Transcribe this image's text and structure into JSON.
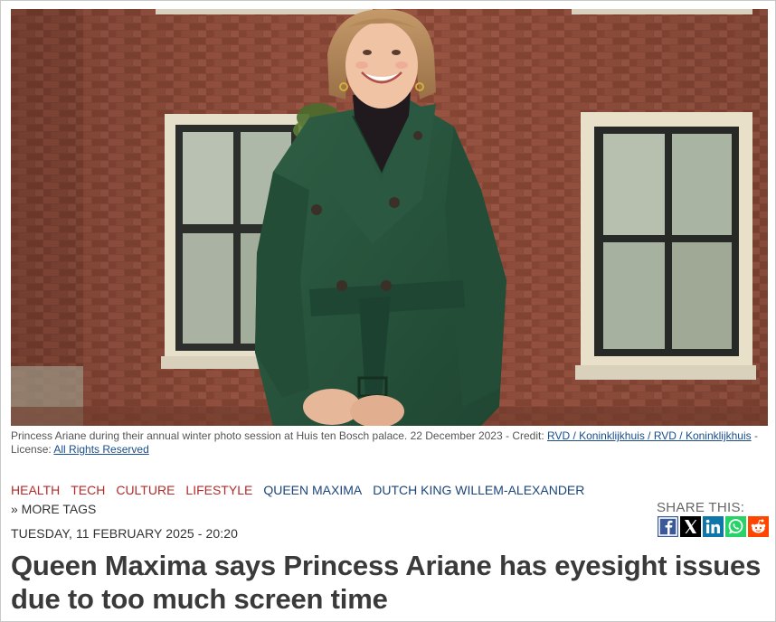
{
  "photo": {
    "alt": "Princess Ariane wearing a green belted wool coat in front of a brick building with white-framed windows"
  },
  "caption": {
    "text": "Princess Ariane during their annual winter photo session at Huis ten Bosch palace. 22 December 2023 - Credit: ",
    "credit_link": "RVD / Koninklijkhuis / RVD / Koninklijkhuis",
    "separator": " - ",
    "license_label": "License: ",
    "license_link": "All Rights Reserved"
  },
  "tags": {
    "items": [
      {
        "label": "HEALTH",
        "color": "#b52b2b"
      },
      {
        "label": "TECH",
        "color": "#b52b2b"
      },
      {
        "label": "CULTURE",
        "color": "#b52b2b"
      },
      {
        "label": "LIFESTYLE",
        "color": "#b52b2b"
      },
      {
        "label": "QUEEN MAXIMA",
        "color": "#1c4578"
      },
      {
        "label": "DUTCH KING WILLEM-ALEXANDER",
        "color": "#1c4578"
      }
    ],
    "more_label": "» MORE TAGS"
  },
  "article": {
    "date": "TUESDAY, 11 FEBRUARY 2025 - 20:20",
    "headline": "Queen Maxima says Princess Ariane has eyesight issues due to too much screen time"
  },
  "share": {
    "label": "SHARE THIS:",
    "buttons": [
      {
        "name": "facebook",
        "icon": "facebook-icon",
        "color": "#3b5998"
      },
      {
        "name": "x",
        "icon": "x-icon",
        "color": "#000000"
      },
      {
        "name": "linkedin",
        "icon": "linkedin-icon",
        "color": "#0e76a8"
      },
      {
        "name": "whatsapp",
        "icon": "whatsapp-icon",
        "color": "#25d366"
      },
      {
        "name": "reddit",
        "icon": "reddit-icon",
        "color": "#ff4500"
      }
    ]
  }
}
